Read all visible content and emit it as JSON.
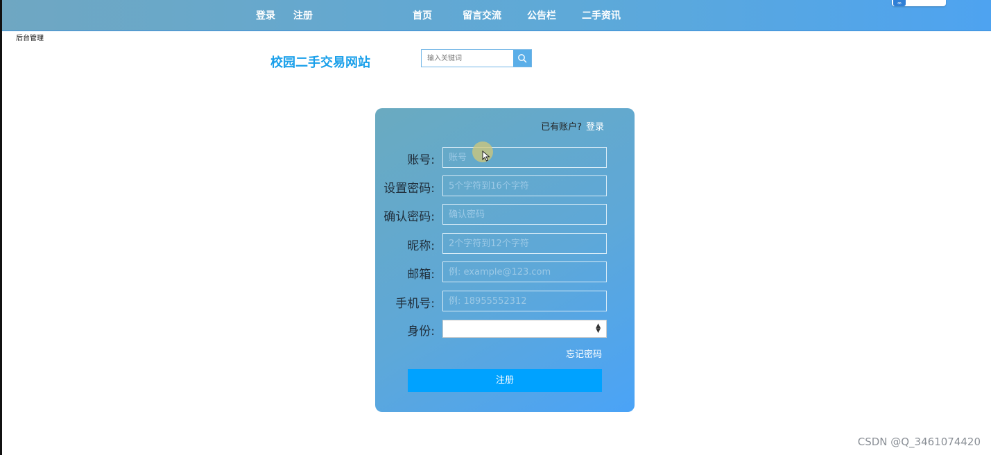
{
  "topnav": {
    "login": "登录",
    "register": "注册",
    "home": "首页",
    "messages": "留言交流",
    "announcements": "公告栏",
    "secondhand": "二手资讯"
  },
  "corner_text": "后台管理",
  "header": {
    "site_title": "校园二手交易网站",
    "search_placeholder": "输入关键词"
  },
  "form": {
    "have_account_text": "已有账户?",
    "login_link": "登录",
    "fields": [
      {
        "label": "账号:",
        "placeholder": "账号"
      },
      {
        "label": "设置密码:",
        "placeholder": "5个字符到16个字符"
      },
      {
        "label": "确认密码:",
        "placeholder": "确认密码"
      },
      {
        "label": "昵称:",
        "placeholder": "2个字符到12个字符"
      },
      {
        "label": "邮箱:",
        "placeholder": "例: example@123.com"
      },
      {
        "label": "手机号:",
        "placeholder": "例: 18955552312"
      }
    ],
    "role_label": "身份:",
    "role_value": "",
    "forgot_password": "忘记密码",
    "submit": "注册"
  },
  "watermark": "CSDN @Q_3461074420",
  "colors": {
    "accent": "#00a2ff",
    "title": "#1aa0ea"
  }
}
